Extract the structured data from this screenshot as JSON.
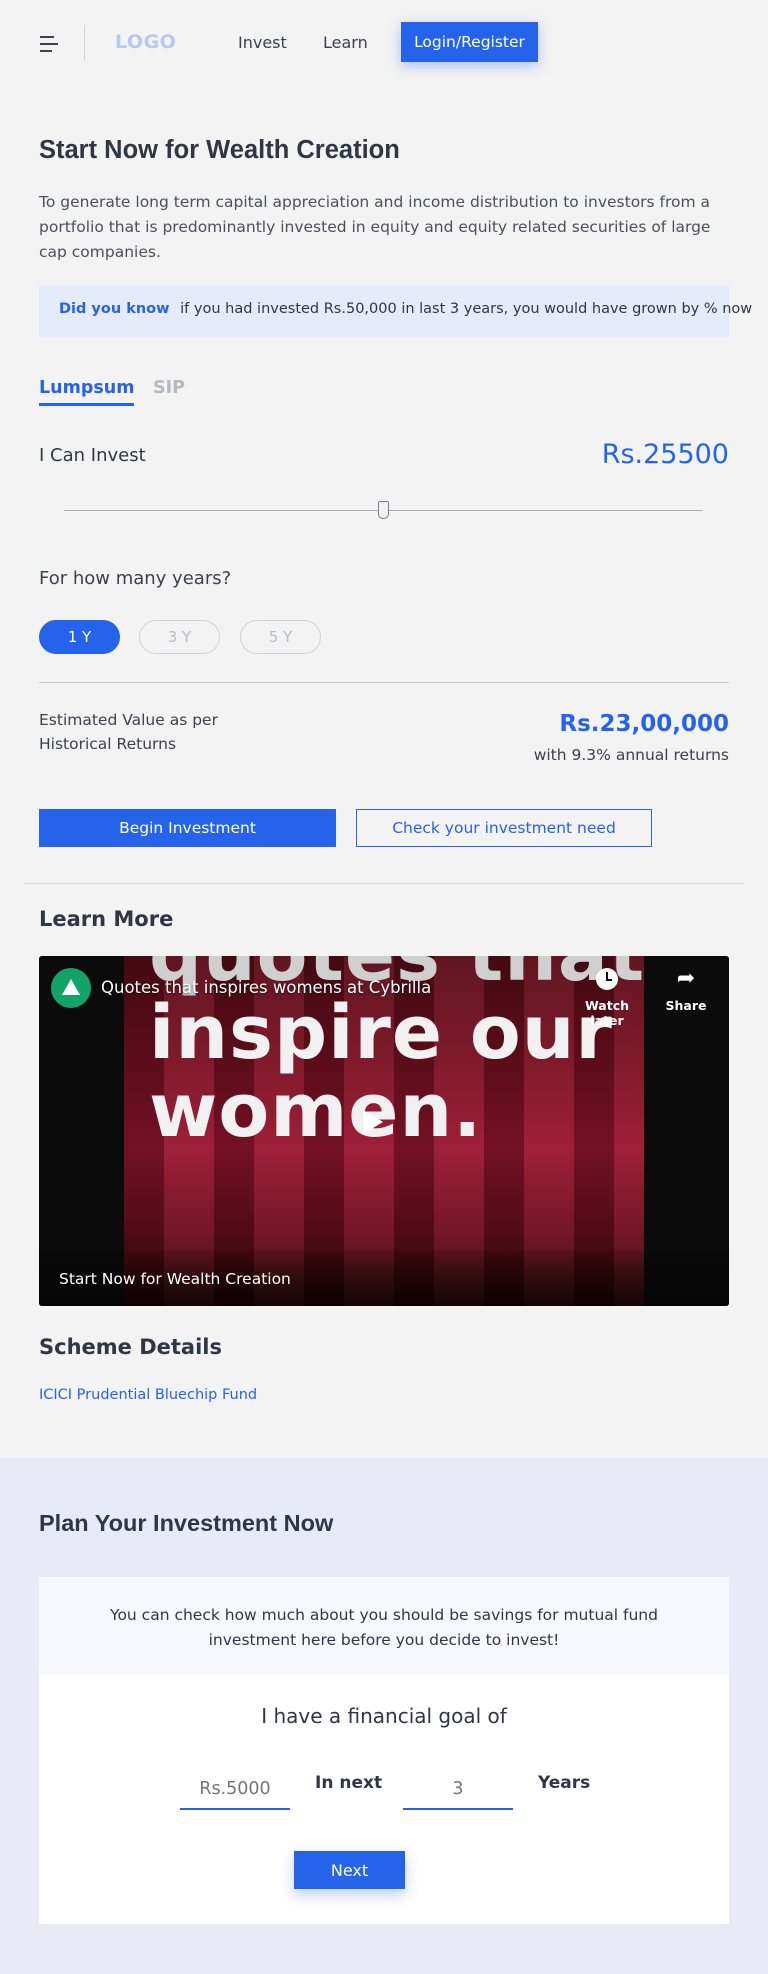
{
  "header": {
    "logo": "LOGO",
    "nav": {
      "invest": "Invest",
      "learn": "Learn"
    },
    "login_label": "Login/Register"
  },
  "hero": {
    "title": "Start Now for Wealth Creation",
    "description": "To generate long term capital appreciation and income distribution to investors from a portfolio that is predominantly invested in equity and equity related securities of large cap companies.",
    "did_you_know_label": "Did you know",
    "did_you_know_text": "if you had invested Rs.50,000 in last 3 years, you would have grown by % now"
  },
  "calculator": {
    "tabs": {
      "lumpsum": "Lumpsum",
      "sip": "SIP"
    },
    "active_tab": "Lumpsum",
    "invest_label": "I Can Invest",
    "invest_amount": "Rs.25500",
    "slider_fraction": 0.5,
    "years_label": "For how many years?",
    "year_options": {
      "one": "1 Y",
      "three": "3 Y",
      "five": "5 Y"
    },
    "selected_year": "1 Y",
    "estimated_label": "Estimated Value as per Historical Returns",
    "estimated_value": "Rs.23,00,000",
    "returns_text": "with 9.3% annual returns",
    "begin_label": "Begin Investment",
    "check_label": "Check your investment need"
  },
  "learn": {
    "title": "Learn More",
    "video": {
      "title": "Quotes that inspires womens at Cybrilla",
      "overlay_text_1": "quotes that",
      "overlay_text_2": "inspire our",
      "overlay_text_3": "women.",
      "watch_later": "Watch later",
      "share": "Share",
      "caption": "Start Now for Wealth Creation"
    }
  },
  "scheme": {
    "title": "Scheme Details",
    "fund_name": "ICICI Prudential Bluechip Fund"
  },
  "plan": {
    "title": "Plan Your Investment Now",
    "intro": "You can check how much about you should be savings for mutual fund investment here before you decide to invest!",
    "goal_label": "I have a financial goal of",
    "amount_placeholder": "Rs.5000",
    "in_next": "In next",
    "years_placeholder": "3",
    "years_word": "Years",
    "next_label": "Next"
  },
  "colors": {
    "accent": "#2563eb",
    "page_bg": "#f3f3f3",
    "plan_bg": "#e8ebf5"
  }
}
